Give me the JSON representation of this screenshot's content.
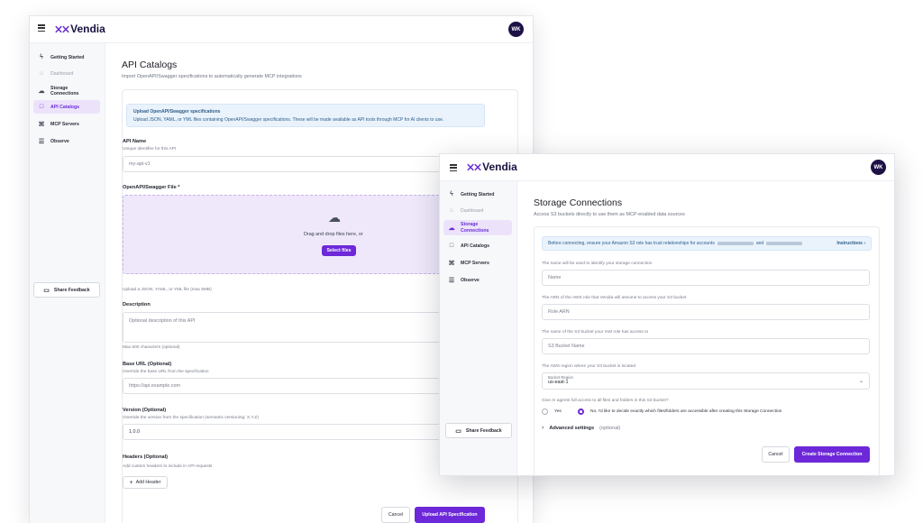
{
  "brand": {
    "name": "Vendia",
    "avatar_initials": "WK",
    "accent": "#6d28d9"
  },
  "nav_items": [
    {
      "label": "Getting Started",
      "icon": "lightning-icon",
      "state": "normal"
    },
    {
      "label": "Dashboard",
      "icon": "home-icon",
      "state": "muted"
    },
    {
      "label": "Storage Connections",
      "icon": "storage-icon",
      "state": "normal"
    },
    {
      "label": "API Catalogs",
      "icon": "book-icon",
      "state": "normal"
    },
    {
      "label": "MCP Servers",
      "icon": "server-icon",
      "state": "normal"
    },
    {
      "label": "Observe",
      "icon": "list-icon",
      "state": "normal"
    }
  ],
  "feedback_label": "Share Feedback",
  "api_catalogs": {
    "title": "API Catalogs",
    "subtitle": "Import OpenAPI/Swagger specifications to automatically generate MCP integrations",
    "info_title": "Upload OpenAPI/Swagger specifications",
    "info_text": "Upload JSON, YAML, or YML files containing OpenAPI/Swagger specifications. These will be made available as API tools through MCP for AI clients to use.",
    "api_name_label": "API Name",
    "api_name_hint": "Unique identifier for this API",
    "api_name_value": "my-api-v1",
    "file_label": "OpenAPI/Swagger File *",
    "drop_text": "Drag and drop files here, or",
    "select_files": "Select files",
    "file_hint": "Upload a JSON, YAML, or YML file (max 5MB)",
    "description_label": "Description",
    "description_placeholder": "Optional description of this API",
    "description_hint": "Max 500 characters (optional)",
    "base_url_label": "Base URL (Optional)",
    "base_url_hint": "Override the base URL from the specification",
    "base_url_placeholder": "https://api.example.com",
    "version_label": "Version (Optional)",
    "version_hint": "Override the version from the specification (semantic versioning: X.Y.Z)",
    "version_value": "1.0.0",
    "headers_label": "Headers (Optional)",
    "headers_hint": "Add custom headers to include in API requests",
    "add_header": "Add Header",
    "cancel": "Cancel",
    "submit": "Upload API Specification"
  },
  "storage": {
    "title": "Storage Connections",
    "subtitle": "Access S3 buckets directly to use them as MCP-enabled data sources",
    "info_text": "Before connecting, ensure your Amazon S3 role has trust relationships for accounts",
    "info_and": "and",
    "instructions": "Instructions ›",
    "name_hint": "The name will be used to identify your storage connection",
    "name_placeholder": "Name",
    "arn_hint": "The ARN of the AWS role that Vendia will assume to access your S3 bucket",
    "arn_placeholder": "Role ARN",
    "bucket_hint": "The name of the S3 bucket your IAM role has access to",
    "bucket_placeholder": "S3 Bucket Name",
    "region_hint": "The AWS region where your S3 bucket is located",
    "region_label": "Bucket Region",
    "region_value": "us-east-1",
    "access_question": "Give AI agents full access to all files and folders in this S3 bucket?",
    "yes_label": "Yes",
    "no_label": "No, I'd like to decide exactly which files/folders are accessible after creating this Storage Connection",
    "advanced_label": "Advanced settings",
    "advanced_optional": "(optional)",
    "cancel": "Cancel",
    "submit": "Create Storage Connection"
  }
}
